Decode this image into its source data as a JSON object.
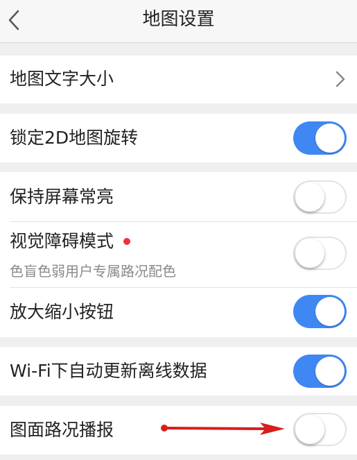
{
  "header": {
    "title": "地图设置"
  },
  "settings": {
    "text_size": {
      "label": "地图文字大小"
    },
    "lock_2d_rotation": {
      "label": "锁定2D地图旋转",
      "enabled": true
    },
    "keep_screen_on": {
      "label": "保持屏幕常亮",
      "enabled": false
    },
    "visual_impairment": {
      "label": "视觉障碍模式",
      "subtitle": "色盲色弱用户专属路况配色",
      "enabled": false,
      "has_new_badge": true
    },
    "zoom_buttons": {
      "label": "放大缩小按钮",
      "enabled": true
    },
    "wifi_auto_update": {
      "label": "Wi-Fi下自动更新离线数据",
      "enabled": true
    },
    "traffic_broadcast": {
      "label": "图面路况播报",
      "enabled": false
    }
  },
  "colors": {
    "toggle_on": "#3f87f3",
    "badge": "#f0303a",
    "annotation_arrow": "#d81e1e"
  },
  "icons": {
    "back": "chevron-left-icon",
    "disclosure": "chevron-right-icon"
  }
}
